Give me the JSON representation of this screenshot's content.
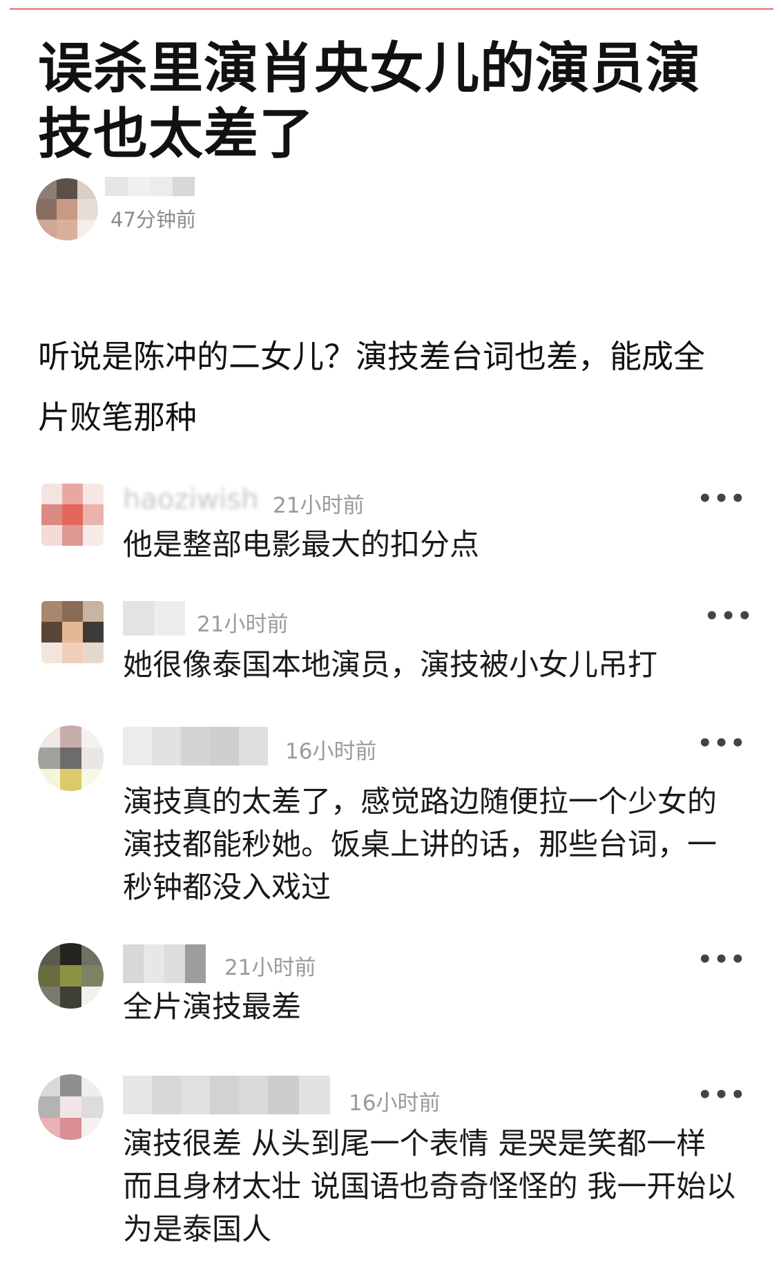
{
  "post": {
    "title": "误杀里演肖央女儿的演员演技也太差了",
    "author_time": "47分钟前",
    "body": "听说是陈冲的二女儿？演技差台词也差，能成全片败笔那种"
  },
  "icons": {
    "more": "more-horizontal-icon"
  },
  "comments": [
    {
      "username": "haoziwish",
      "time": "21小时前",
      "text": "他是整部电影最大的扣分点",
      "more": "•••"
    },
    {
      "username": "",
      "time": "21小时前",
      "text": "她很像泰国本地演员，演技被小女儿吊打",
      "more": "•••"
    },
    {
      "username": "",
      "time": "16小时前",
      "text": "演技真的太差了，感觉路边随便拉一个少女的演技都能秒她。饭桌上讲的话，那些台词，一秒钟都没入戏过",
      "more": "•••"
    },
    {
      "username": "",
      "time": "21小时前",
      "text": "全片演技最差",
      "more": "•••"
    },
    {
      "username": "",
      "time": "16小时前",
      "text": "演技很差 从头到尾一个表情 是哭是笑都一样 而且身材太壮 说国语也奇奇怪怪的 我一开始以为是泰国人",
      "more": "•••"
    }
  ],
  "colors": {
    "accent_rule": "#e86a6a",
    "meta_gray": "#9a9a9a"
  }
}
